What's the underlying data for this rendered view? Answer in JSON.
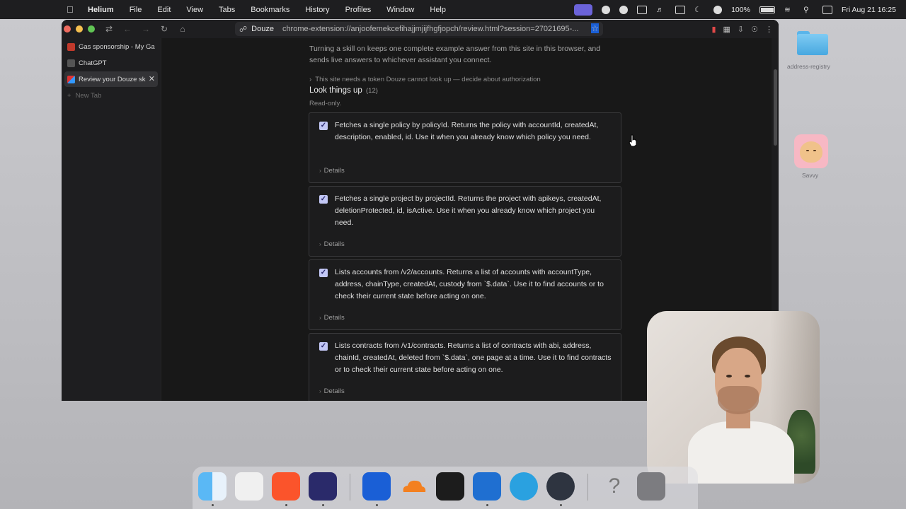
{
  "menubar": {
    "app_name": "Helium",
    "items": [
      "File",
      "Edit",
      "View",
      "Tabs",
      "Bookmarks",
      "History",
      "Profiles",
      "Window",
      "Help"
    ],
    "battery": "100%",
    "datetime": "Fri Aug 21  16:25"
  },
  "browser": {
    "address": {
      "site_name": "Douze",
      "url": "chrome-extension://anjoofemekcefihajjmjijfhgfjopch/review.html?session=27021695-..."
    },
    "tabs": [
      {
        "label": "Gas sponsorship - My Ga"
      },
      {
        "label": "ChatGPT"
      },
      {
        "label": "Review your Douze sk"
      }
    ],
    "new_tab_label": "New Tab"
  },
  "page": {
    "intro": "Turning a skill on keeps one complete example answer from this site in this browser, and sends live answers to whichever assistant you connect.",
    "token_note": "This site needs a token Douze cannot look up — decide about authorization",
    "section_title": "Look things up",
    "section_count": "(12)",
    "read_only": "Read-only.",
    "details_label": "Details",
    "skills": [
      {
        "checked": true,
        "description": "Fetches a single policy by policyId. Returns the policy with accountId, createdAt, description, enabled, id. Use it when you already know which policy you need."
      },
      {
        "checked": true,
        "description": "Fetches a single project by projectId. Returns the project with apikeys, createdAt, deletionProtected, id, isActive. Use it when you already know which project you need."
      },
      {
        "checked": true,
        "description": "Lists accounts from /v2/accounts. Returns a list of accounts with accountType, address, chainType, createdAt, custody from `$.data`. Use it to find accounts or to check their current state before acting on one."
      },
      {
        "checked": true,
        "description": "Lists contracts from /v1/contracts. Returns a list of contracts with abi, address, chainId, createdAt, deleted from `$.data`, one page at a time. Use it to find contracts or to check their current state before acting on one."
      }
    ]
  },
  "desktop": {
    "folder_label": "address-registry",
    "app_label": "Savvy"
  }
}
